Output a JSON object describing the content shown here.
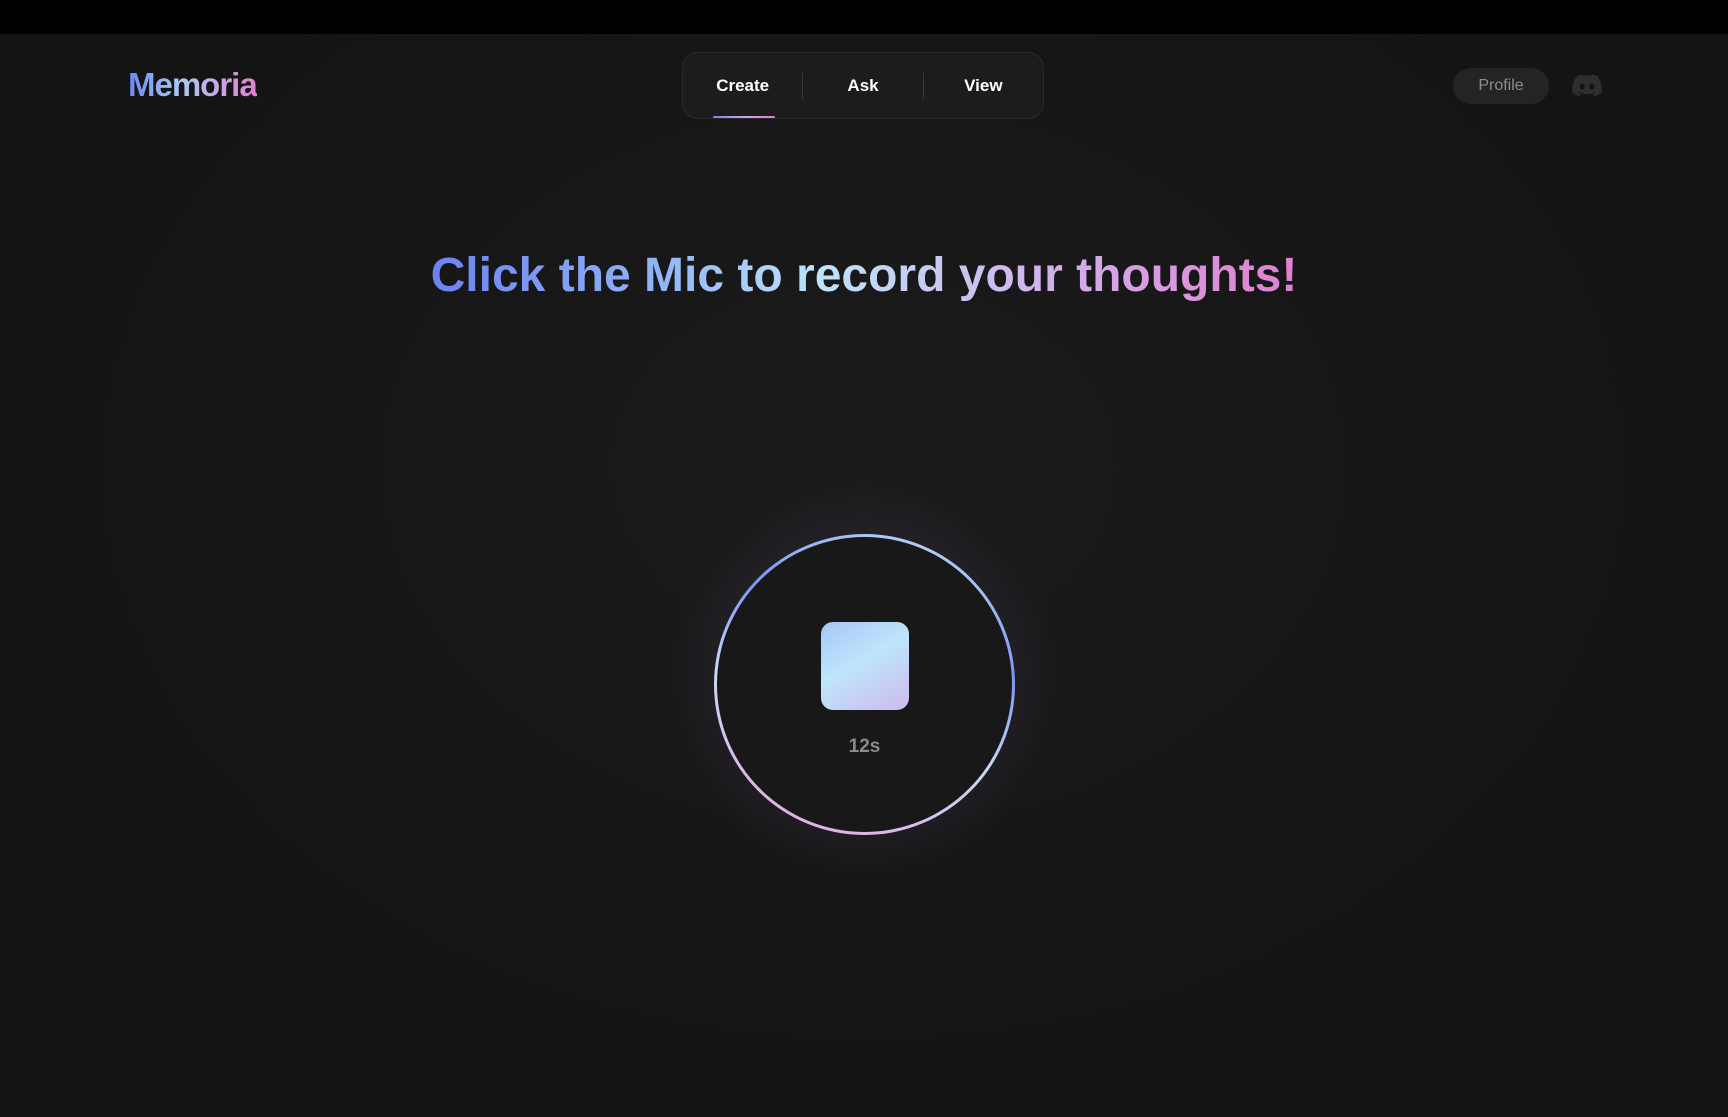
{
  "app": {
    "logo": "Memoria"
  },
  "nav": {
    "tabs": [
      {
        "label": "Create",
        "active": true
      },
      {
        "label": "Ask",
        "active": false
      },
      {
        "label": "View",
        "active": false
      }
    ]
  },
  "header": {
    "profile_label": "Profile",
    "discord_icon": "discord-icon"
  },
  "main": {
    "headline": "Click the Mic to record your thoughts!",
    "recorder": {
      "state_icon": "stop-icon",
      "timer": "12s"
    }
  },
  "colors": {
    "gradient_start": "#6f86f2",
    "gradient_mid": "#bfe3f8",
    "gradient_end": "#e07fd0",
    "background": "#141414"
  }
}
